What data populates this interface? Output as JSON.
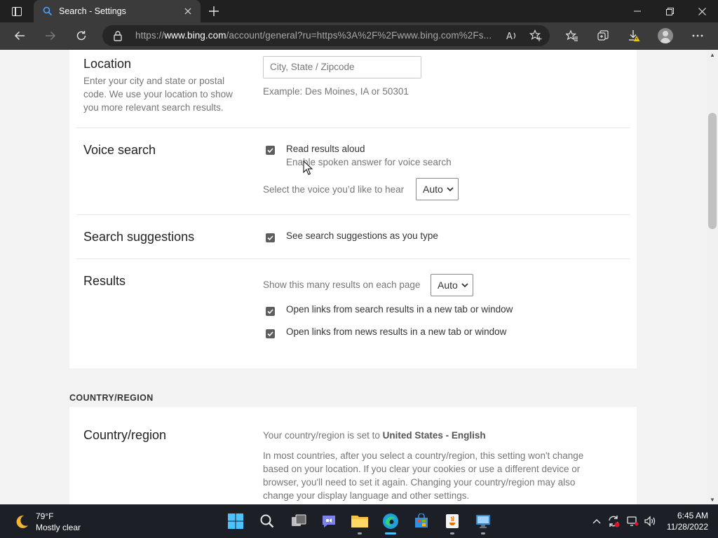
{
  "browser": {
    "tab": {
      "title": "Search - Settings"
    },
    "address": {
      "url_prefix": "https://",
      "url_domain": "www.bing.com",
      "url_path": "/account/general?ru=https%3A%2F%2Fwww.bing.com%2Fs..."
    }
  },
  "settings": {
    "location": {
      "title": "Location",
      "description": "Enter your city and state or postal code. We use your location to show you more relevant search results.",
      "input_placeholder": "City, State / Zipcode",
      "example": "Example: Des Moines, IA or 50301"
    },
    "voice_search": {
      "title": "Voice search",
      "read_aloud_label": "Read results aloud",
      "read_aloud_sub": "Enable spoken answer for voice search",
      "read_aloud_checked": true,
      "voice_label": "Select the voice you’d like to hear",
      "voice_value": "Auto"
    },
    "suggestions": {
      "title": "Search suggestions",
      "label": "See search suggestions as you type",
      "checked": true
    },
    "results": {
      "title": "Results",
      "count_label": "Show this many results on each page",
      "count_value": "Auto",
      "new_tab_search_label": "Open links from search results in a new tab or window",
      "new_tab_search_checked": true,
      "new_tab_news_label": "Open links from news results in a new tab or window",
      "new_tab_news_checked": true
    },
    "country_section": {
      "heading": "COUNTRY/REGION",
      "title": "Country/region",
      "set_prefix": "Your country/region is set to ",
      "set_value": "United States - English",
      "note": "In most countries, after you select a country/region, this setting won't change based on your location. If you clear your cookies or use a different device or browser, you'll need to set it again. Changing your country/region may also change your display language and other settings."
    }
  },
  "taskbar": {
    "weather": {
      "temp": "79°F",
      "condition": "Mostly clear"
    },
    "clock": {
      "time": "6:45 AM",
      "date": "11/28/2022"
    }
  },
  "colors": {
    "accent": "#4cc2ff",
    "checkbox": "#5e5e5e",
    "page_bg": "#f3f3f3"
  }
}
